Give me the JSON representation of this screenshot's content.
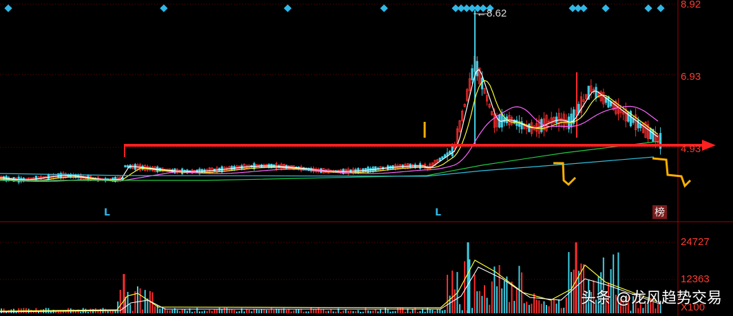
{
  "price_axis": {
    "labels": [
      "8.92",
      "6.93",
      "4.93"
    ]
  },
  "volume_axis": {
    "labels": [
      "24727",
      "12363",
      "X100"
    ]
  },
  "peak_label": "←8.62",
  "markers": {
    "low_signal": "L",
    "rank_badge": "榜"
  },
  "watermark": "头条 @龙风趋势交易",
  "colors": {
    "up": "#ff2d2d",
    "down": "#3fd0e6",
    "ma5": "#ffffff",
    "ma10": "#ffff33",
    "ma20": "#ff66ff",
    "ma60": "#22cc44",
    "ma120": "#30c0e0",
    "annotation_arrow": "#ff2020",
    "annotation_marks": "#ffb000",
    "axis_text": "#ff3b30"
  },
  "chart_data": {
    "type": "line",
    "title": "",
    "series": [
      {
        "name": "",
        "values": []
      }
    ],
    "ylim": [
      3.4,
      9.0
    ],
    "y_ticks": [
      8.92,
      6.93,
      4.93
    ],
    "volume_ylim": [
      0,
      27000
    ],
    "volume_ticks": [
      24727,
      12363
    ],
    "volume_unit": "X100",
    "peak_value": 8.62
  }
}
